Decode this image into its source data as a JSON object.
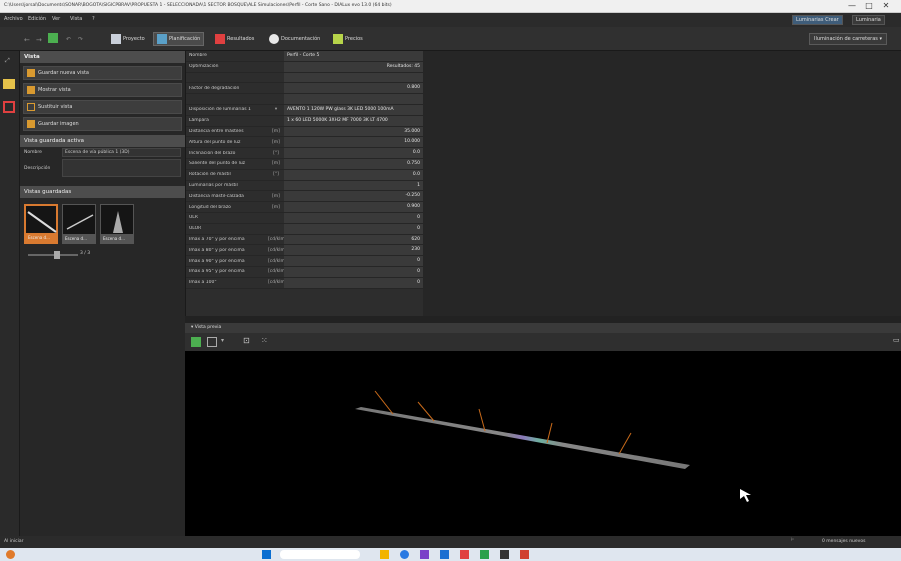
{
  "window": {
    "title": "C:\\Users\\jorsal\\Documents\\SONAR\\BOGOTA\\SIGICPBRAV\\PROPUESTA 1 - SELECCIONADA\\1 SECTOR BOSQUE\\ALE Simulaciones\\Perfil - Corte Sano - DIALux evo 13.0 (64 bits)"
  },
  "menu": {
    "items": [
      "Archivo",
      "Edición",
      "Ver",
      "Vista",
      "?"
    ],
    "right_buttons": [
      "Luminarias Crear",
      "Luminaria"
    ],
    "controls": [
      "—",
      "□",
      "✕"
    ]
  },
  "toolbar": {
    "tabs": [
      {
        "label": "Proyecto",
        "color": "#c9cfd9"
      },
      {
        "label": "Planificación",
        "color": "#5aa0c8",
        "active": true
      },
      {
        "label": "Resultados",
        "color": "#e04040"
      },
      {
        "label": "Documentación",
        "color": "#e8e8e8"
      },
      {
        "label": "Precios",
        "color": "#b7d44a"
      }
    ],
    "dropdown": "Iluminación de carreteras"
  },
  "left_panel": {
    "header": "Vista",
    "buttons": [
      {
        "label": "Guardar nueva vista",
        "color": "#d99a30"
      },
      {
        "label": "Mostrar vista",
        "color": "#d99a30"
      },
      {
        "label": "Sustituir vista",
        "color": "#d99a30"
      },
      {
        "label": "Guardar imagen",
        "color": "#d99a30"
      }
    ],
    "active_view_header": "Vista guardada activa",
    "form": [
      {
        "label": "Nombre",
        "value": "Escena de vía pública 1 (3D)"
      },
      {
        "label": "Descripción",
        "value": ""
      }
    ],
    "saved_views_header": "Vistas guardadas",
    "thumbnails": [
      "Escena d...",
      "Escena d...",
      "Escena d..."
    ],
    "slider_value": "3 / 3"
  },
  "properties": {
    "rows": [
      {
        "label": "Nombre",
        "unit": "",
        "value": "Perfil - Corte 5",
        "align": "left"
      },
      {
        "label": "Optimización",
        "unit": "",
        "value": "Resultados: 45",
        "align": "right"
      },
      {
        "label": "",
        "unit": "",
        "value": "",
        "align": "right"
      },
      {
        "label": "Factor de degradación",
        "unit": "",
        "value": "0.800",
        "align": "right"
      },
      {
        "label": "",
        "unit": "",
        "value": "",
        "align": "right"
      },
      {
        "label": "Disposición de luminarias 1",
        "unit": "▾",
        "value": "AVENTO 1 120W PW glass 3K LED 5000 100mA",
        "align": "left"
      },
      {
        "label": "Lámpara",
        "unit": "",
        "value": "1 x 60 LED 5000K 3XH2 MF 7000 3K LT 4700",
        "align": "left"
      },
      {
        "label": "Distancia entre mástiles",
        "unit": "[m]",
        "value": "35.000",
        "align": "right"
      },
      {
        "label": "Altura del punto de luz",
        "unit": "[m]",
        "value": "10.000",
        "align": "right"
      },
      {
        "label": "Inclinación del brazo",
        "unit": "[°]",
        "value": "0.0",
        "align": "right"
      },
      {
        "label": "Saliente del punto de luz",
        "unit": "[m]",
        "value": "0.750",
        "align": "right"
      },
      {
        "label": "Rotación de mástil",
        "unit": "[°]",
        "value": "0.0",
        "align": "right"
      },
      {
        "label": "Luminarias por mástil",
        "unit": "",
        "value": "1",
        "align": "right"
      },
      {
        "label": "Distancia mástil-calzada",
        "unit": "[m]",
        "value": "-0.250",
        "align": "right"
      },
      {
        "label": "Longitud del brazo",
        "unit": "[m]",
        "value": "0.900",
        "align": "right"
      },
      {
        "label": "ULR",
        "unit": "",
        "value": "0",
        "align": "right"
      },
      {
        "label": "ULOR",
        "unit": "",
        "value": "0",
        "align": "right"
      },
      {
        "label": "Imax a 70° y por encima",
        "unit": "[cd/klm]",
        "value": "620",
        "align": "right"
      },
      {
        "label": "Imax a 80° y por encima",
        "unit": "[cd/klm]",
        "value": "230",
        "align": "right"
      },
      {
        "label": "Imax a 90° y por encima",
        "unit": "[cd/klm]",
        "value": "0",
        "align": "right"
      },
      {
        "label": "Imax a 95° y por encima",
        "unit": "[cd/klm]",
        "value": "0",
        "align": "right"
      },
      {
        "label": "Imax a 100°",
        "unit": "[cd/klm]",
        "value": "0",
        "align": "right"
      }
    ]
  },
  "view3d": {
    "header": "Vista previa"
  },
  "statusbar": {
    "left": "Al iniciar",
    "right": "0 mensajes nuevos"
  }
}
